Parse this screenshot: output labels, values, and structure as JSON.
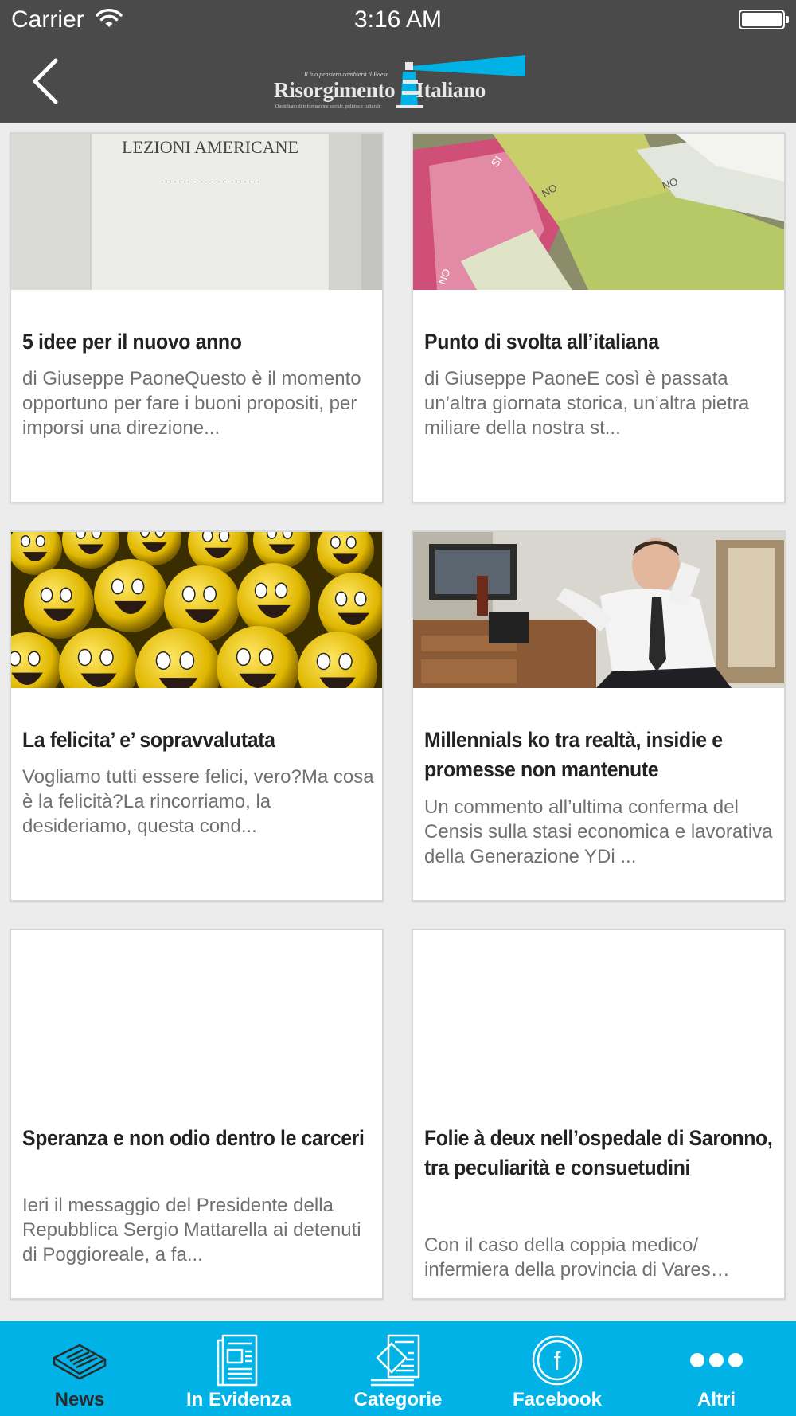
{
  "status_bar": {
    "carrier": "Carrier",
    "time": "3:16 AM"
  },
  "header": {
    "logo": {
      "tagline": "Il tuo pensiero cambierà il Paese",
      "name_left": "Risorgimento",
      "name_right": "Italiano",
      "subline": "Quotidiano di informazione sociale, politica e culturale"
    }
  },
  "articles": [
    {
      "title": "5 idee per il nuovo anno",
      "excerpt": "di Giuseppe PaoneQuesto è il momento opportuno per fare i buoni propositi, per imporsi una direzione...",
      "image": "book-lezioni-americane",
      "image_text": "LEZIONI AMERICANE"
    },
    {
      "title": "Punto di svolta all’italiana",
      "excerpt": "di Giuseppe PaoneE così è passata un’altra giornata storica, un’altra pietra miliare della nostra st...",
      "image": "referendum-ballots",
      "image_text": ""
    },
    {
      "title": "La felicita’ e’ sopravvalutata",
      "excerpt": "Vogliamo tutti essere felici, vero?Ma cosa è la felicità?La rincorriamo, la desideriamo, questa cond...",
      "image": "smiley-balls",
      "image_text": ""
    },
    {
      "title": "Millennials ko tra realtà, insidie e promesse non mantenute",
      "excerpt": "Un commento all’ultima conferma del Censis sulla stasi economica e lavorativa della Generazione YDi ...",
      "image": "office-worker",
      "image_text": ""
    },
    {
      "title": "Speranza e non odio dentro le carceri",
      "excerpt": "Ieri il messaggio del Presidente della Repubblica Sergio Mattarella ai detenuti di Poggioreale, a fa...",
      "image": "blank",
      "image_text": ""
    },
    {
      "title": "Folie à deux nell’ospedale di Saronno, tra peculiarità e consuetudini",
      "excerpt": "Con il caso della coppia medico/ infermiera della provincia di Vares…",
      "image": "blank",
      "image_text": ""
    }
  ],
  "tab_bar": {
    "tabs": [
      {
        "label": "News",
        "icon": "newspaper-icon",
        "active": true
      },
      {
        "label": "In Evidenza",
        "icon": "featured-news-icon",
        "active": false
      },
      {
        "label": "Categorie",
        "icon": "categories-icon",
        "active": false
      },
      {
        "label": "Facebook",
        "icon": "facebook-icon",
        "active": false
      },
      {
        "label": "Altri",
        "icon": "more-icon",
        "active": false
      }
    ]
  },
  "colors": {
    "bar": "#4a4a4a",
    "tab_bar": "#00b2e6",
    "active_tab_label": "#2a2a2a",
    "title": "#222222",
    "excerpt": "#707070"
  }
}
